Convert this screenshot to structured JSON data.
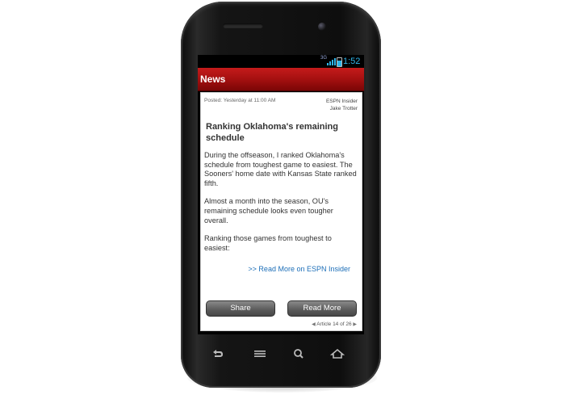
{
  "status_bar": {
    "network": "3G",
    "time": "1:52"
  },
  "app": {
    "title": "News"
  },
  "article": {
    "posted": "Posted: Yesterday at 11:00 AM",
    "source": "ESPN Insider",
    "author": "Jake Trotter",
    "headline": "Ranking Oklahoma's remaining schedule",
    "paragraphs": [
      "During the offseason, I ranked Oklahoma's schedule from toughest game to easiest. The Sooners' home date with Kansas State ranked fifth.",
      "Almost a month into the season, OU's remaining schedule looks even tougher overall.",
      "Ranking those games from toughest to easiest:"
    ],
    "read_more": ">> Read More on ESPN Insider"
  },
  "buttons": {
    "share": "Share",
    "read_more": "Read More"
  },
  "pager": {
    "label": "Article 14 of 26"
  },
  "colors": {
    "accent_red": "#b31313",
    "link_blue": "#1d6fb8",
    "status_blue": "#2fb4e8"
  },
  "nav_icons": [
    "back-icon",
    "menu-icon",
    "search-icon",
    "home-icon"
  ]
}
